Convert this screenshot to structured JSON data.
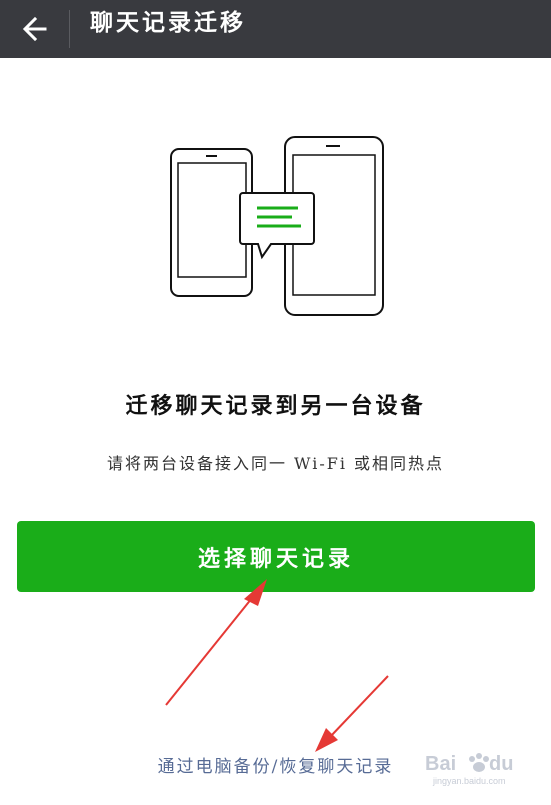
{
  "header": {
    "title": "聊天记录迁移",
    "back_icon": "arrow-left-icon"
  },
  "illustration": {
    "icons": [
      "phone-icon",
      "phone-icon",
      "chat-bubble-icon"
    ],
    "accent_color": "#1aad19"
  },
  "main": {
    "heading": "迁移聊天记录到另一台设备",
    "subtext": "请将两台设备接入同一 Wi-Fi 或相同热点",
    "primary_button": "选择聊天记录",
    "pc_link": "通过电脑备份/恢复聊天记录"
  },
  "watermark": {
    "brand": "Baidu",
    "domain": "jingyan.baidu.com"
  },
  "colors": {
    "header_bg": "#393a3f",
    "primary": "#1aad19",
    "link": "#576b95",
    "annotation_arrow": "#e53935"
  }
}
